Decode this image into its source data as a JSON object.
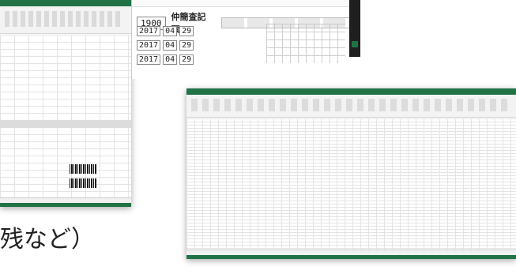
{
  "caption": {
    "text": "残など）"
  },
  "form": {
    "year": "1900",
    "title": "仲簡査記票",
    "rows": [
      {
        "y": "2017",
        "m": "04",
        "d": "29"
      },
      {
        "y": "2017",
        "m": "04",
        "d": "29"
      },
      {
        "y": "2017",
        "m": "04",
        "d": "29"
      }
    ]
  },
  "colors": {
    "excel_green": "#217346",
    "dark_panel": "#1f1f1f"
  },
  "icons": [
    "excel-icon",
    "barcode"
  ]
}
